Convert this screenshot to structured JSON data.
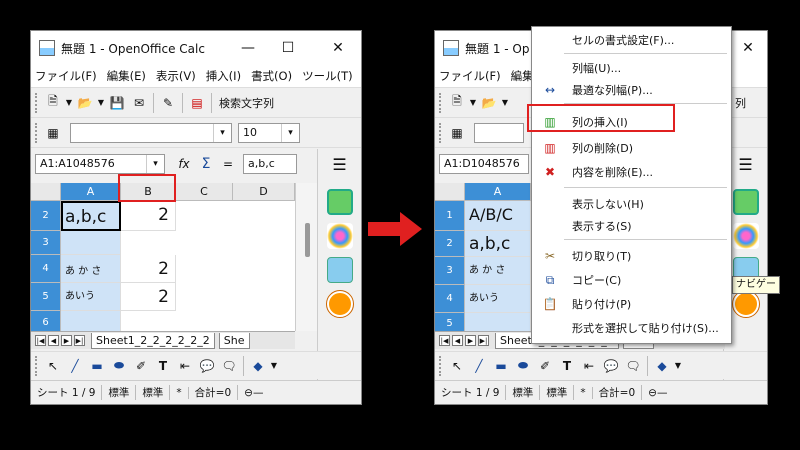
{
  "colors": {
    "accent": "#3d8fd6",
    "highlight": "#e02020"
  },
  "window1": {
    "title": "無題 1 - OpenOffice Calc",
    "menus": [
      "ファイル(F)",
      "編集(E)",
      "表示(V)",
      "挿入(I)",
      "書式(O)",
      "ツール(T)"
    ],
    "search_label": "検索文字列",
    "font_size": "10",
    "name_box": "A1:A1048576",
    "formula_value": "a,b,c",
    "columns": [
      "A",
      "B",
      "C",
      "D"
    ],
    "rows": [
      "2",
      "3",
      "4",
      "5",
      "6"
    ],
    "cells": {
      "r2a": "a,b,c",
      "r2b": "2",
      "r4a": "あ か さ",
      "r4b": "2",
      "r5a": "あいう",
      "r5b": "2"
    },
    "sheet_tab": "Sheet1_2_2_2_2_2_2",
    "sheet_tab2": "She",
    "status": {
      "sheet": "シート 1 / 9",
      "style": "標準",
      "mode": "標準",
      "star": "*",
      "sum": "合計=0"
    }
  },
  "window2": {
    "title": "無題 1 - Op",
    "menus": [
      "ファイル(F)",
      "編集"
    ],
    "tb_suffix": "列",
    "name_box": "A1:D1048576",
    "columns": [
      "A"
    ],
    "rows": [
      "1",
      "2",
      "3",
      "4",
      "5"
    ],
    "cells": {
      "r1a": "A/B/C",
      "r2a": "a,b,c",
      "r3a": "あ か さ",
      "r4a": "あいう"
    },
    "sheet_tab": "Sheet1_2_2_2_2_2_2",
    "sheet_tab2": "She",
    "status": {
      "sheet": "シート 1 / 9",
      "style": "標準",
      "mode": "標準",
      "star": "*",
      "sum": "合計=0"
    }
  },
  "context_menu": [
    {
      "label": "セルの書式設定(F)...",
      "icon": ""
    },
    {
      "label": "列幅(U)...",
      "icon": ""
    },
    {
      "label": "最適な列幅(P)...",
      "icon": "optimal-width-icon"
    },
    {
      "label": "列の挿入(I)",
      "icon": "insert-column-icon"
    },
    {
      "label": "列の削除(D)",
      "icon": "delete-column-icon"
    },
    {
      "label": "内容を削除(E)...",
      "icon": "delete-contents-icon"
    },
    {
      "label": "表示しない(H)",
      "icon": ""
    },
    {
      "label": "表示する(S)",
      "icon": ""
    },
    {
      "label": "切り取り(T)",
      "icon": "cut-icon"
    },
    {
      "label": "コピー(C)",
      "icon": "copy-icon"
    },
    {
      "label": "貼り付け(P)",
      "icon": "paste-icon"
    },
    {
      "label": "形式を選択して貼り付け(S)...",
      "icon": ""
    }
  ],
  "tooltip": "ナビゲー"
}
